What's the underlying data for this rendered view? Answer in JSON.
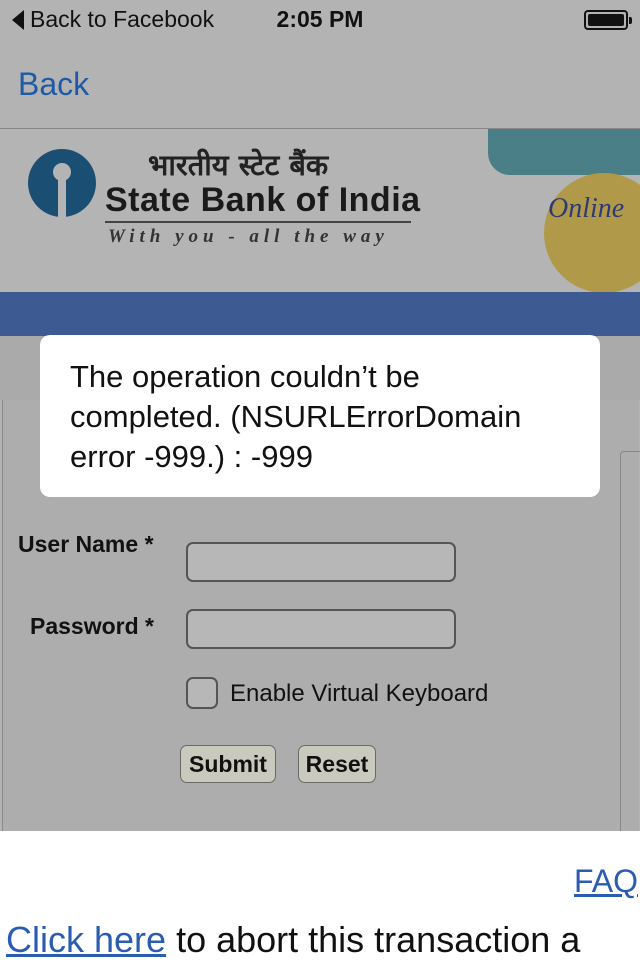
{
  "status_bar": {
    "back_label": "Back to Facebook",
    "time": "2:05 PM",
    "battery_icon": "battery-full-icon"
  },
  "nav": {
    "back_label": "Back"
  },
  "header": {
    "hindi_name": "भारतीय स्टेट बैंक",
    "bank_name": "State Bank of India",
    "tagline": "With you - all the way",
    "online_label": "Online",
    "logo_icon": "sbi-logo-icon"
  },
  "login_form": {
    "username_label": "User Name *",
    "username_value": "",
    "password_label": "Password *",
    "password_value": "",
    "virtual_keyboard_label": "Enable Virtual Keyboard",
    "virtual_keyboard_checked": false,
    "submit_label": "Submit",
    "reset_label": "Reset"
  },
  "footer": {
    "faq_label": "FAQ",
    "click_here_label": "Click here",
    "abort_text": " to abort this transaction a"
  },
  "alert": {
    "message": "The operation couldn’t be completed. (NSURLErrorDomain error -999.) : -999"
  },
  "colors": {
    "link": "#2a5db0",
    "nav_link": "#1f5aa6",
    "brand_bar": "#3d5a93"
  }
}
